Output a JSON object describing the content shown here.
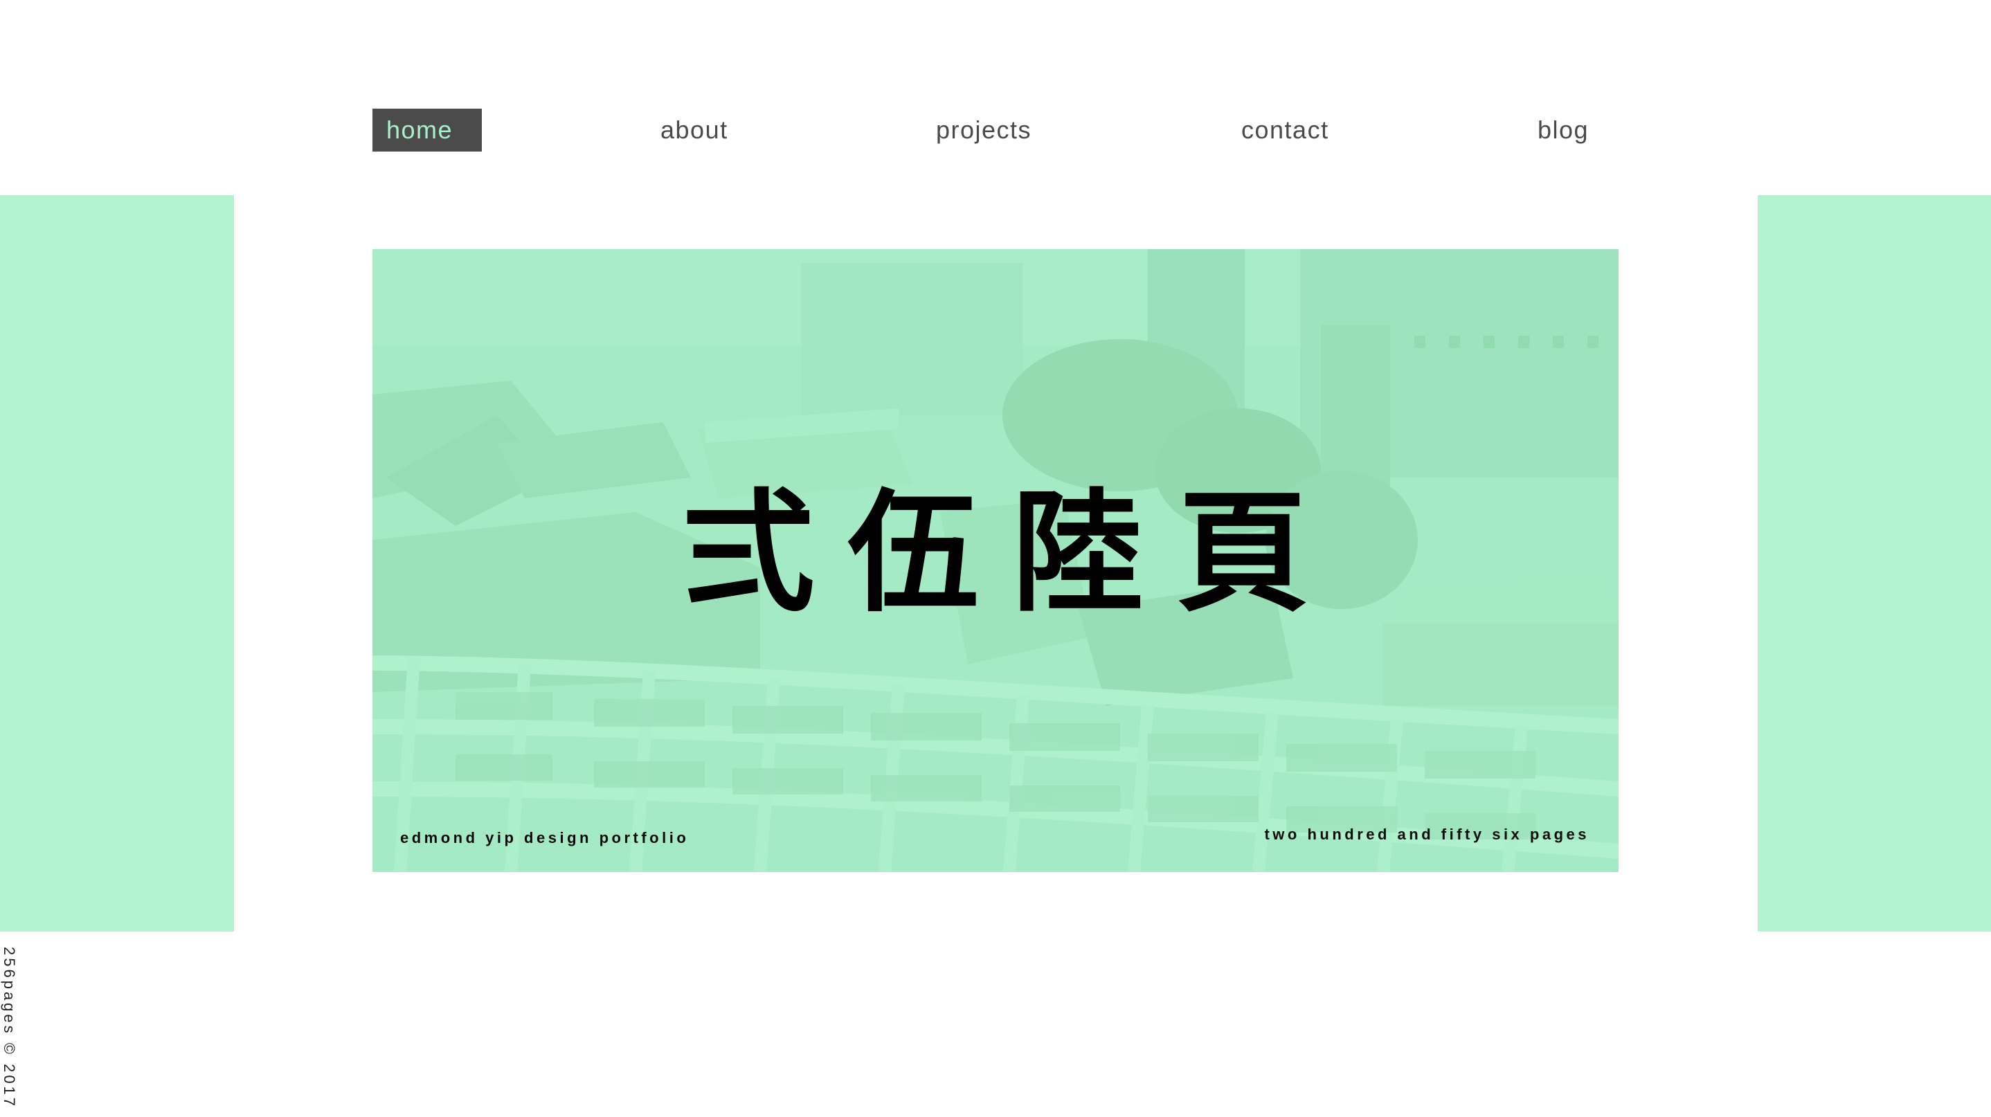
{
  "nav": {
    "items": [
      {
        "id": "home",
        "label": "home",
        "active": true
      },
      {
        "id": "about",
        "label": "about",
        "active": false
      },
      {
        "id": "projects",
        "label": "projects",
        "active": false
      },
      {
        "id": "contact",
        "label": "contact",
        "active": false
      },
      {
        "id": "blog",
        "label": "blog",
        "active": false
      }
    ]
  },
  "hero": {
    "title": "弍伍陸頁",
    "caption_left": "edmond yip design portfolio",
    "caption_right": "two hundred and fifty six pages"
  },
  "footer": {
    "copyright": "256pages © 2017"
  },
  "colors": {
    "accent_mint": "#b2f2cf",
    "hero_overlay": "#9fe6c0",
    "nav_active_bg": "#4b4b4b",
    "nav_active_text": "#a8f0c8",
    "nav_text": "#4a4a4a"
  }
}
